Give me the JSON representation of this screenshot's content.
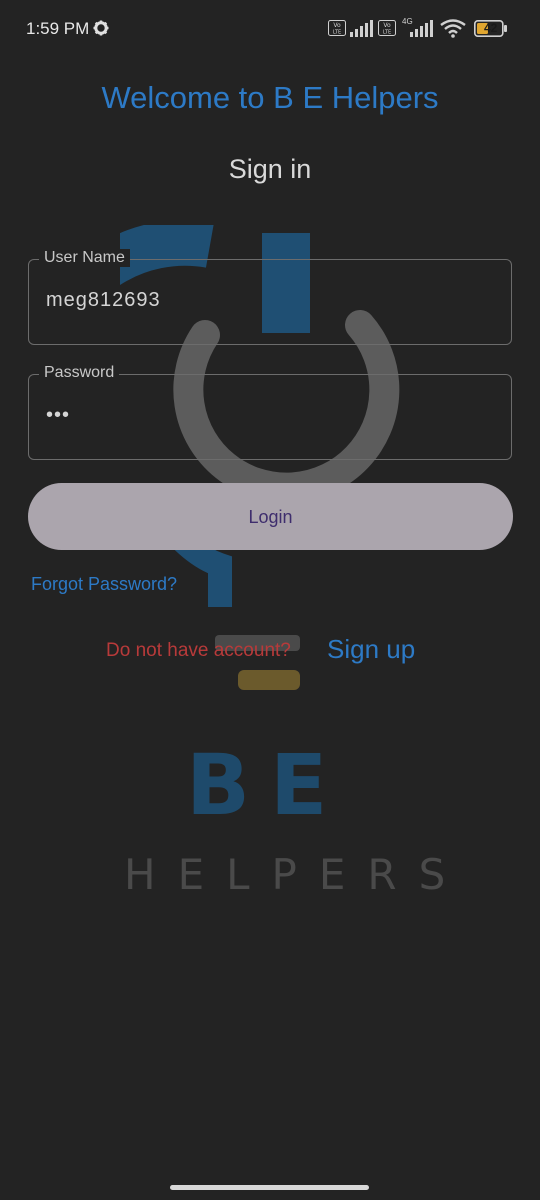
{
  "status_bar": {
    "time": "1:59 PM",
    "battery": "42",
    "network": "4G",
    "icons": [
      "gear-icon",
      "volte-icon",
      "signal-icon",
      "volte-icon",
      "signal-icon",
      "wifi-icon",
      "battery-icon"
    ]
  },
  "header": {
    "welcome": "Welcome to B E Helpers",
    "subtitle": "Sign in"
  },
  "form": {
    "username": {
      "label": "User Name",
      "value": "meg812693"
    },
    "password": {
      "label": "Password",
      "value": "•••"
    },
    "login_label": "Login",
    "forgot_label": "Forgot Password?",
    "no_account_text": "Do not have account?",
    "signup_label": "Sign up"
  },
  "logo": {
    "line1": "BE",
    "line2": "HELPERS"
  },
  "colors": {
    "background": "#232323",
    "accent_blue": "#2d7ac6",
    "error_red": "#b83a3a",
    "button_bg": "#aba5ad",
    "button_text": "#3e2d6d"
  }
}
